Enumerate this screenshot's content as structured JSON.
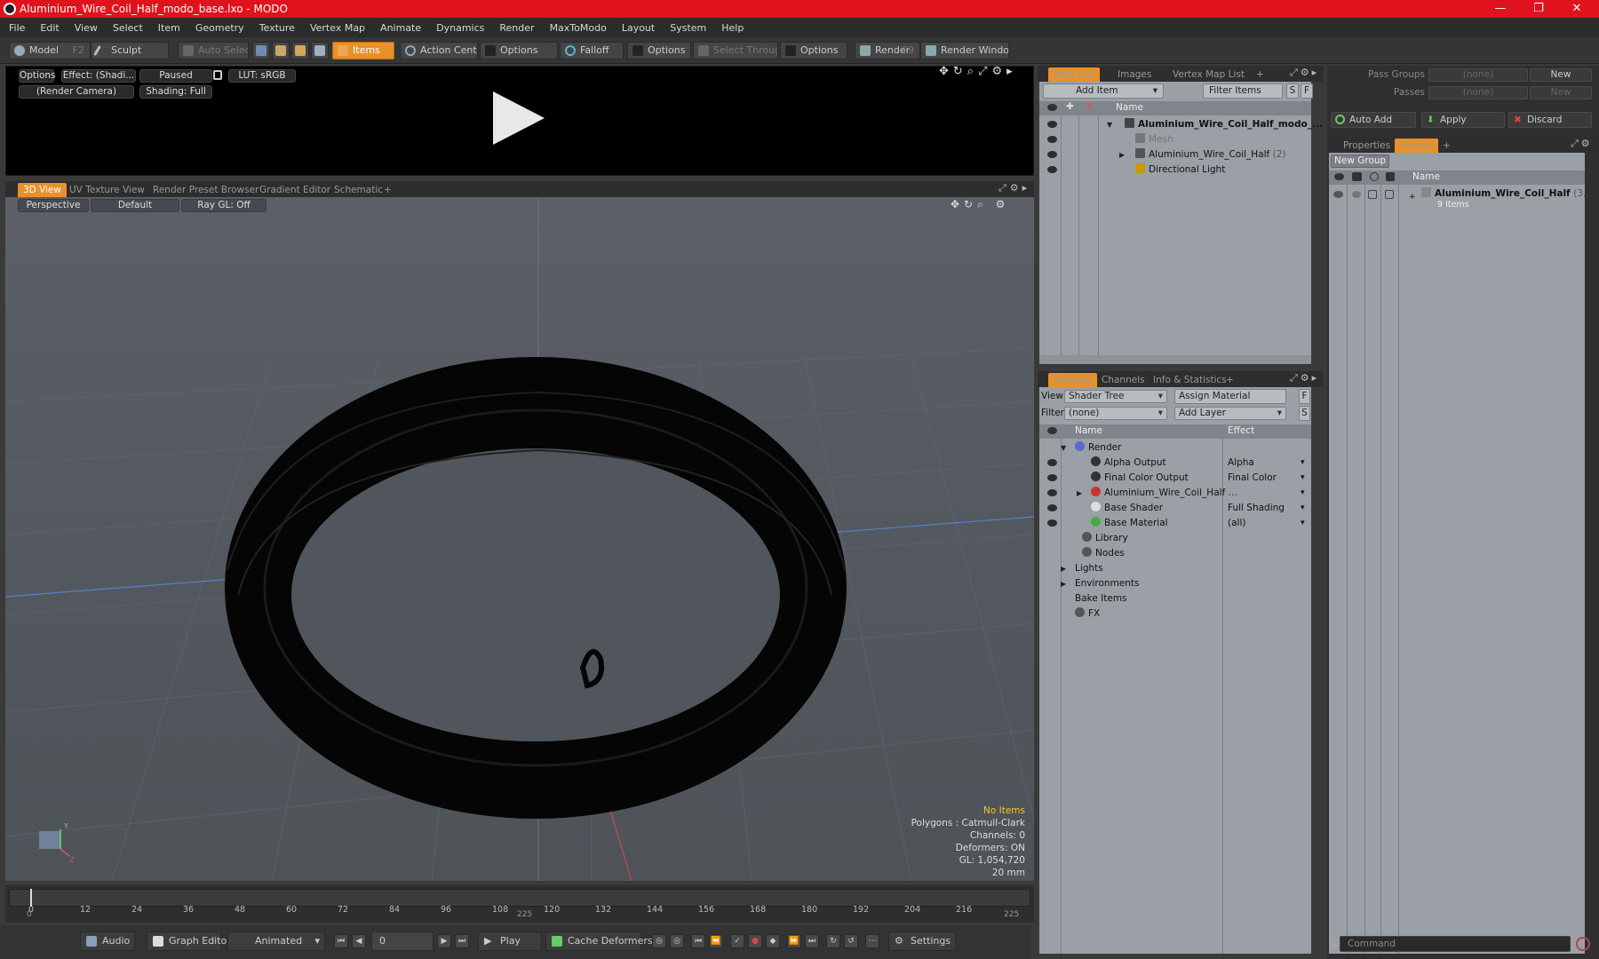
{
  "window": {
    "title": "Aluminium_Wire_Coil_Half_modo_base.lxo - MODO",
    "minimize": "—",
    "maximize": "❐",
    "close": "✕"
  },
  "menu": [
    "File",
    "Edit",
    "View",
    "Select",
    "Item",
    "Geometry",
    "Texture",
    "Vertex Map",
    "Animate",
    "Dynamics",
    "Render",
    "MaxToModo",
    "Layout",
    "System",
    "Help"
  ],
  "toolbar": {
    "model": "Model",
    "model_key": "F2",
    "sculpt": "Sculpt",
    "auto_select": "Auto Select",
    "items": "Items",
    "action_center": "Action Center",
    "options1": "Options",
    "falloff": "Falloff",
    "options2": "Options",
    "select_through": "Select Through",
    "options3": "Options",
    "render": "Render",
    "render_key": "F9",
    "render_window": "Render Window"
  },
  "preview": {
    "options": "Options",
    "effect": "Effect: (Shadi...",
    "paused": "Paused",
    "lut": "LUT: sRGB",
    "camera": "(Render Camera)",
    "shading": "Shading: Full",
    "play_icon": "play-icon"
  },
  "viewport_tabs": [
    "3D View",
    "UV Texture View",
    "Render Preset Browser",
    "Gradient Editor",
    "Schematic",
    "+"
  ],
  "viewport": {
    "perspective": "Perspective",
    "default": "Default",
    "raygl": "Ray GL: Off",
    "stats": {
      "no_items": "No Items",
      "polygons": "Polygons : Catmull-Clark",
      "channels": "Channels: 0",
      "deformers": "Deformers: ON",
      "gl": "GL: 1,054,720",
      "unit": "20 mm"
    },
    "axis_x": "X",
    "axis_y": "Y",
    "axis_z": "Z"
  },
  "timeline": {
    "ticks": [
      "0",
      "12",
      "24",
      "36",
      "48",
      "60",
      "72",
      "84",
      "96",
      "108",
      "120",
      "132",
      "144",
      "156",
      "168",
      "180",
      "192",
      "204",
      "216"
    ],
    "start": "0",
    "mid": "225",
    "end": "225"
  },
  "bottom": {
    "audio": "Audio",
    "graph_editor": "Graph Editor",
    "animated": "Animated",
    "frame": "0",
    "play": "Play",
    "cache_deformers": "Cache Deformers",
    "settings": "Settings"
  },
  "item_list": {
    "tabs": [
      "Item List",
      "Images",
      "Vertex Map List",
      "+"
    ],
    "add_item": "Add Item",
    "filter_items": "Filter Items",
    "s": "S",
    "f": "F",
    "col_name": "Name",
    "rows": [
      {
        "label": "Aluminium_Wire_Coil_Half_modo_...",
        "bold": true
      },
      {
        "label": "Mesh",
        "dim": true
      },
      {
        "label": "Aluminium_Wire_Coil_Half",
        "count": "(2)"
      },
      {
        "label": "Directional Light"
      }
    ]
  },
  "shading": {
    "tabs": [
      "Shading",
      "Channels",
      "Info & Statistics",
      "+"
    ],
    "view_label": "View",
    "view_value": "Shader Tree",
    "assign_material": "Assign Material",
    "filter_label": "Filter",
    "filter_value": "(none)",
    "add_layer": "Add Layer",
    "f": "F",
    "s": "S",
    "col_name": "Name",
    "col_effect": "Effect",
    "rows": [
      {
        "label": "Render",
        "effect": ""
      },
      {
        "label": "Alpha Output",
        "effect": "Alpha"
      },
      {
        "label": "Final Color Output",
        "effect": "Final Color"
      },
      {
        "label": "Aluminium_Wire_Coil_Half",
        "effect": ""
      },
      {
        "label": "Base Shader",
        "effect": "Full Shading"
      },
      {
        "label": "Base Material",
        "effect": "(all)"
      },
      {
        "label": "Library",
        "effect": ""
      },
      {
        "label": "Nodes",
        "effect": ""
      },
      {
        "label": "Lights",
        "effect": ""
      },
      {
        "label": "Environments",
        "effect": ""
      },
      {
        "label": "Bake Items",
        "effect": ""
      },
      {
        "label": "FX",
        "effect": ""
      }
    ]
  },
  "groups": {
    "pass_groups": "Pass Groups",
    "passes": "Passes",
    "none": "(none)",
    "new1": "New",
    "new2": "New",
    "auto_add": "Auto Add",
    "apply": "Apply",
    "discard": "Discard",
    "tabs": [
      "Properties",
      "Groups",
      "+"
    ],
    "new_group": "New Group",
    "col_name": "Name",
    "group_name": "Aluminium_Wire_Coil_Half",
    "group_suffix": "(3...",
    "group_items": "9 Items"
  },
  "command": {
    "placeholder": "Command"
  }
}
